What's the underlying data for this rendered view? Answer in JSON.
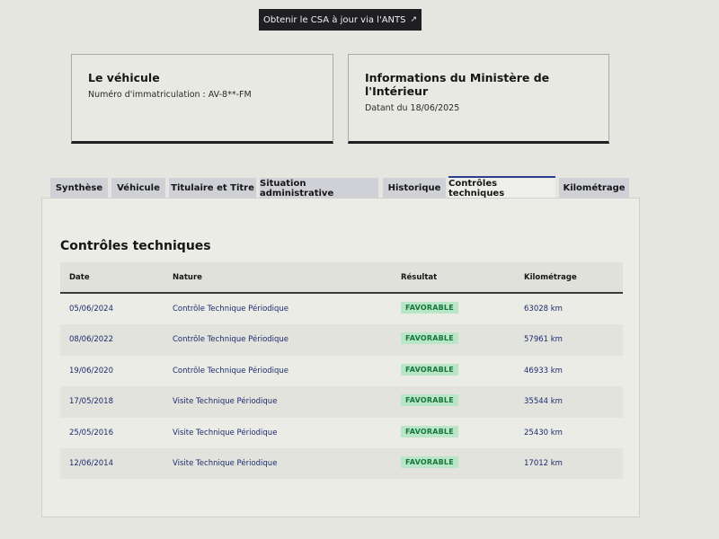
{
  "header": {
    "ants_button_label": "Obtenir le CSA à jour via l'ANTS",
    "ants_button_icon": "external-link-icon"
  },
  "vehicle_card": {
    "title": "Le véhicule",
    "registration": "Numéro d'immatriculation : AV-8**-FM"
  },
  "ministry_card": {
    "title": "Informations du Ministère de l'Intérieur",
    "date": "Datant du 18/06/2025"
  },
  "tabs": [
    {
      "label": "Synthèse",
      "active": false
    },
    {
      "label": "Véhicule",
      "active": false
    },
    {
      "label": "Titulaire et Titre",
      "active": false
    },
    {
      "label": "Situation administrative",
      "active": false
    },
    {
      "label": "Historique",
      "active": false
    },
    {
      "label": "Contrôles techniques",
      "active": true
    },
    {
      "label": "Kilométrage",
      "active": false
    }
  ],
  "section": {
    "title": "Contrôles techniques",
    "columns": {
      "date": "Date",
      "nature": "Nature",
      "result": "Résultat",
      "mileage": "Kilométrage"
    },
    "rows": [
      {
        "date": "05/06/2024",
        "nature": "Contrôle Technique Périodique",
        "result": "FAVORABLE",
        "mileage": "63028 km"
      },
      {
        "date": "08/06/2022",
        "nature": "Contrôle Technique Périodique",
        "result": "FAVORABLE",
        "mileage": "57961 km"
      },
      {
        "date": "19/06/2020",
        "nature": "Contrôle Technique Périodique",
        "result": "FAVORABLE",
        "mileage": "46933 km"
      },
      {
        "date": "17/05/2018",
        "nature": "Visite Technique Périodique",
        "result": "FAVORABLE",
        "mileage": "35544 km"
      },
      {
        "date": "25/05/2016",
        "nature": "Visite Technique Périodique",
        "result": "FAVORABLE",
        "mileage": "25430 km"
      },
      {
        "date": "12/06/2014",
        "nature": "Visite Technique Périodique",
        "result": "FAVORABLE",
        "mileage": "17012 km"
      }
    ]
  },
  "colors": {
    "accent": "#2c3f8f",
    "favorable_bg": "#b8e6c6",
    "favorable_text": "#18753c",
    "dark_button": "#1f1f23"
  }
}
